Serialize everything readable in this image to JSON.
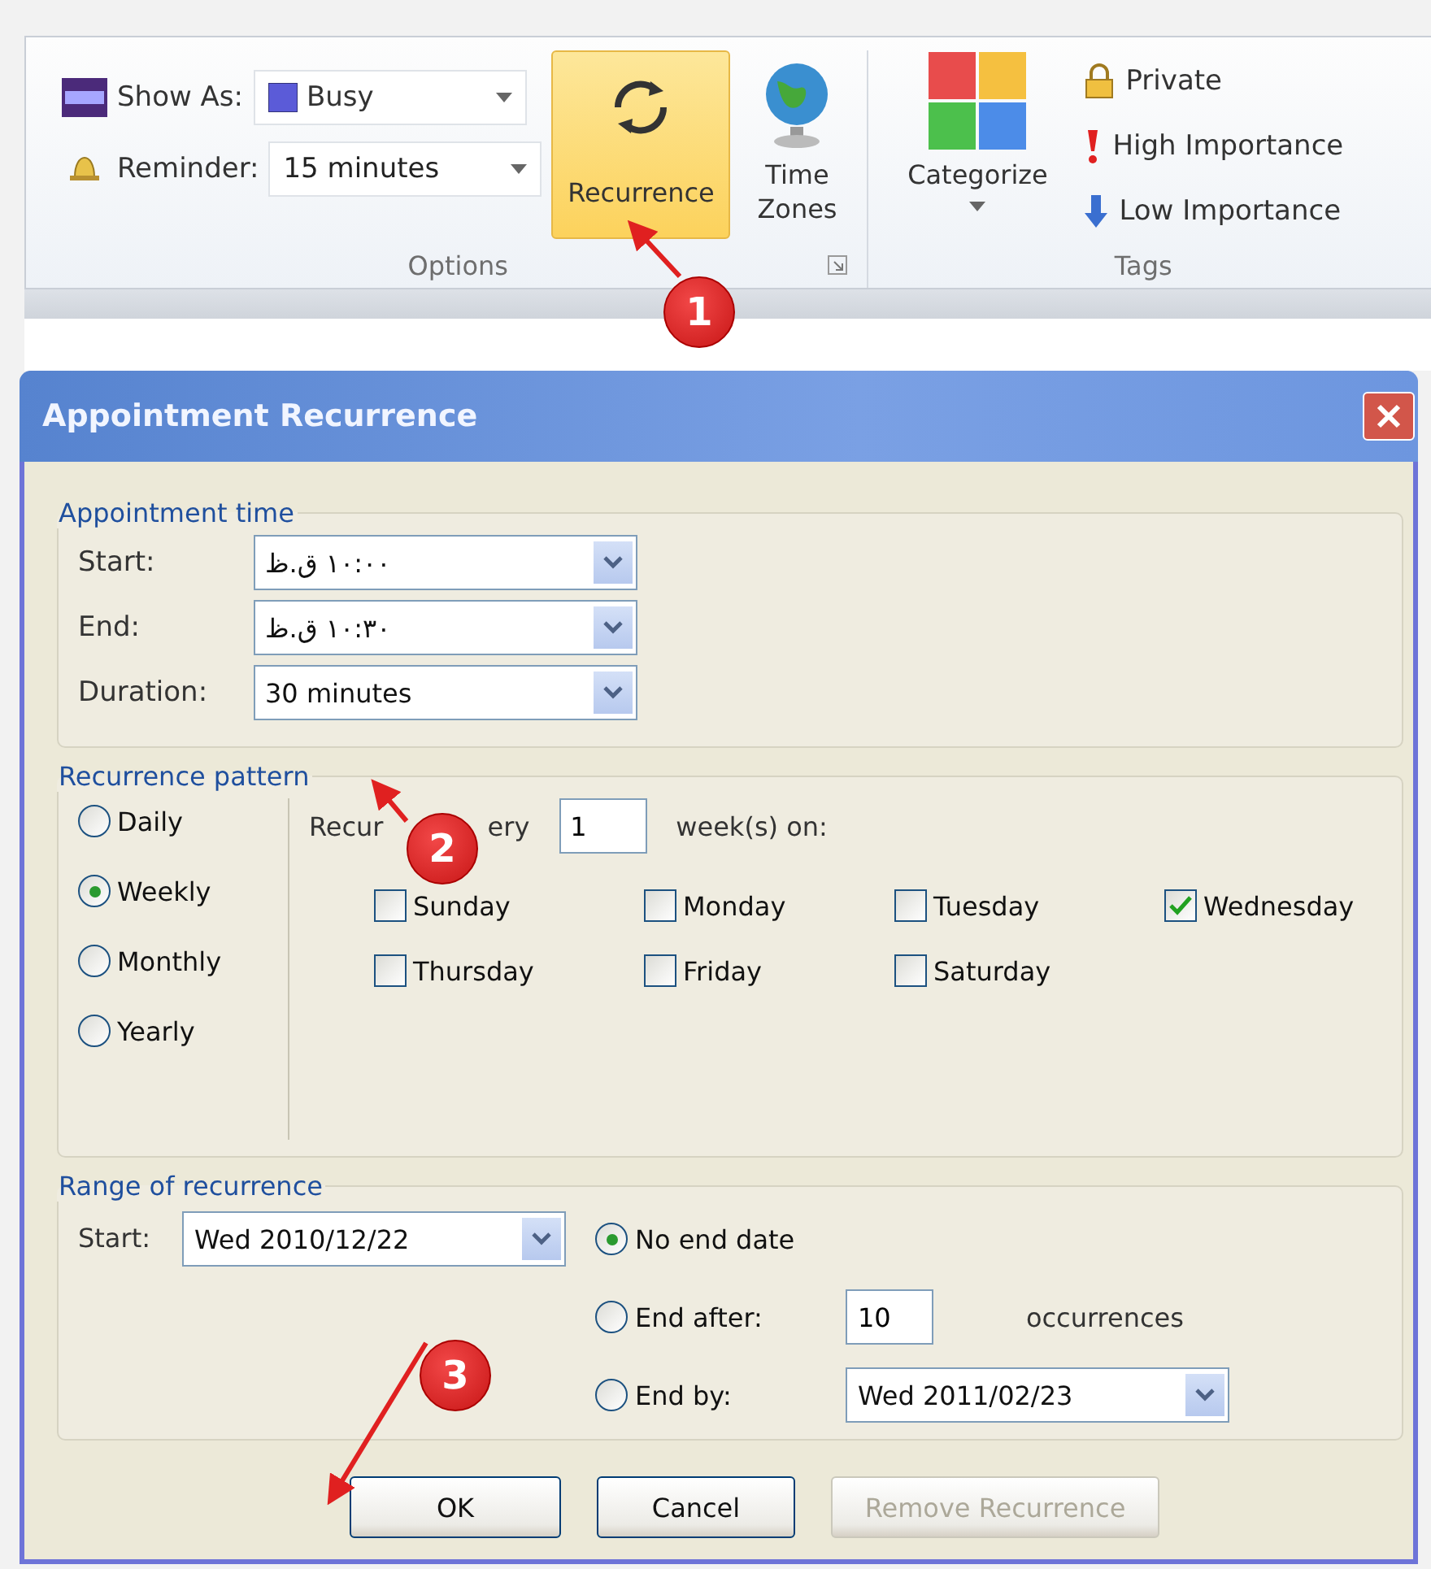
{
  "ribbon": {
    "options_group": {
      "show_as": {
        "label": "Show As:",
        "value": "Busy"
      },
      "reminder": {
        "label": "Reminder:",
        "value": "15 minutes"
      },
      "recurrence_button": {
        "label": "Recurrence",
        "selected": true
      },
      "time_zones_button": {
        "label": "Time Zones"
      },
      "title": "Options"
    },
    "tags_group": {
      "categorize_button": {
        "label": "Categorize"
      },
      "items": [
        {
          "kind": "lock",
          "label": "Private"
        },
        {
          "kind": "high",
          "label": "High Importance"
        },
        {
          "kind": "low",
          "label": "Low Importance"
        }
      ],
      "title": "Tags"
    }
  },
  "dialog": {
    "title": "Appointment Recurrence",
    "appointment_time": {
      "title": "Appointment time",
      "fields": [
        {
          "label": "Start:",
          "value": "۱۰:۰۰ ق.ظ"
        },
        {
          "label": "End:",
          "value": "۱۰:۳۰ ق.ظ"
        },
        {
          "label": "Duration:",
          "value": "30 minutes"
        }
      ]
    },
    "recurrence_pattern": {
      "title": "Recurrence pattern",
      "frequencies": [
        {
          "label": "Daily",
          "selected": false
        },
        {
          "label": "Weekly",
          "selected": true
        },
        {
          "label": "Monthly",
          "selected": false
        },
        {
          "label": "Yearly",
          "selected": false
        }
      ],
      "recur_text_start": "Recur",
      "recur_text_end": "ery",
      "interval": "1",
      "interval_unit": "week(s) on:",
      "days": [
        {
          "label": "Sunday",
          "checked": false
        },
        {
          "label": "Monday",
          "checked": false
        },
        {
          "label": "Tuesday",
          "checked": false
        },
        {
          "label": "Wednesday",
          "checked": true
        },
        {
          "label": "Thursday",
          "checked": false
        },
        {
          "label": "Friday",
          "checked": false
        },
        {
          "label": "Saturday",
          "checked": false
        }
      ]
    },
    "range": {
      "title": "Range of recurrence",
      "start_label": "Start:",
      "start_value": "Wed 2010/12/22",
      "end_options": [
        {
          "kind": "none",
          "label": "No end date",
          "selected": true
        },
        {
          "kind": "after",
          "label": "End after:",
          "selected": false,
          "value": "10",
          "unit": "occurrences"
        },
        {
          "kind": "by",
          "label": "End by:",
          "selected": false,
          "value": "Wed 2011/02/23"
        }
      ]
    },
    "buttons": [
      {
        "label": "OK",
        "disabled": false
      },
      {
        "label": "Cancel",
        "disabled": false
      },
      {
        "label": "Remove Recurrence",
        "disabled": true
      }
    ]
  },
  "annotations": [
    {
      "number": "1"
    },
    {
      "number": "2"
    },
    {
      "number": "3"
    }
  ]
}
